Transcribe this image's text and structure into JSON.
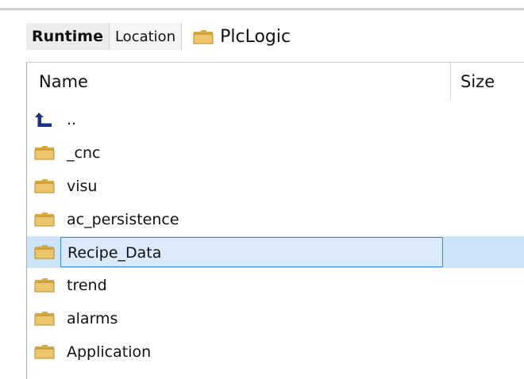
{
  "toolbar": {
    "tab_runtime": "Runtime",
    "tab_location": "Location",
    "path": "PlcLogic"
  },
  "list": {
    "header_name": "Name",
    "header_size": "Size",
    "rows": [
      {
        "label": "..",
        "icon": "up-arrow-icon"
      },
      {
        "label": "_cnc",
        "icon": "folder-icon"
      },
      {
        "label": "visu",
        "icon": "folder-icon"
      },
      {
        "label": "ac_persistence",
        "icon": "folder-icon"
      },
      {
        "label": "Recipe_Data",
        "icon": "folder-icon",
        "selected": true
      },
      {
        "label": "trend",
        "icon": "folder-icon"
      },
      {
        "label": "alarms",
        "icon": "folder-icon"
      },
      {
        "label": "Application",
        "icon": "folder-icon"
      }
    ]
  },
  "colors": {
    "folder_fill": "#e9c46a",
    "folder_tab": "#d9a93f",
    "selection_bg": "#cde3f7",
    "selection_border": "#3b8ae0",
    "up_arrow": "#1a2f8a"
  }
}
